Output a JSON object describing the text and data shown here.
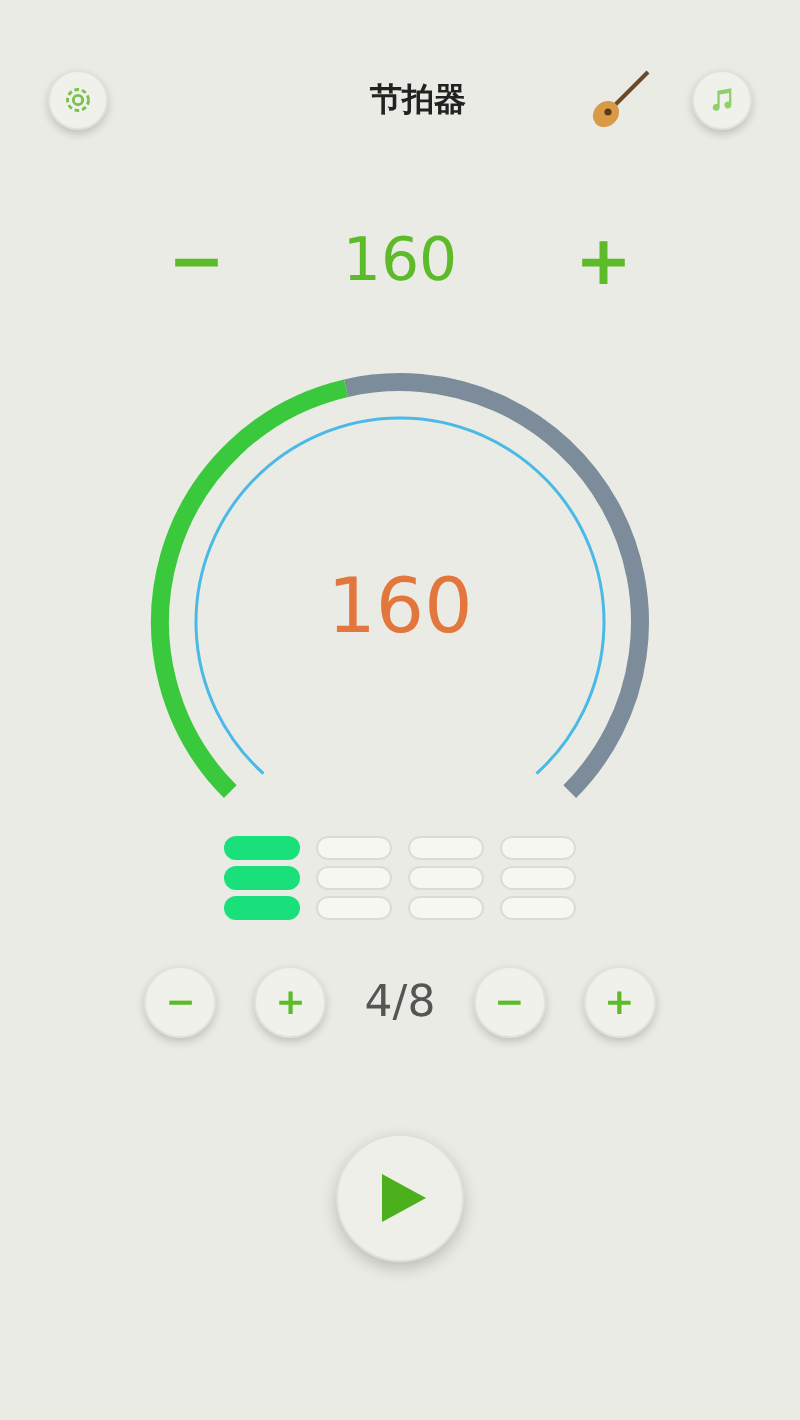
{
  "header": {
    "title": "节拍器"
  },
  "tempo": {
    "minus": "−",
    "value": "160",
    "plus": "+"
  },
  "gauge": {
    "value": "160"
  },
  "beats": [
    {
      "active": true
    },
    {
      "active": false
    },
    {
      "active": false
    },
    {
      "active": false
    }
  ],
  "meter": {
    "beats_minus": "−",
    "beats_plus": "+",
    "signature": "4/8",
    "unit_minus": "−",
    "unit_plus": "+"
  }
}
